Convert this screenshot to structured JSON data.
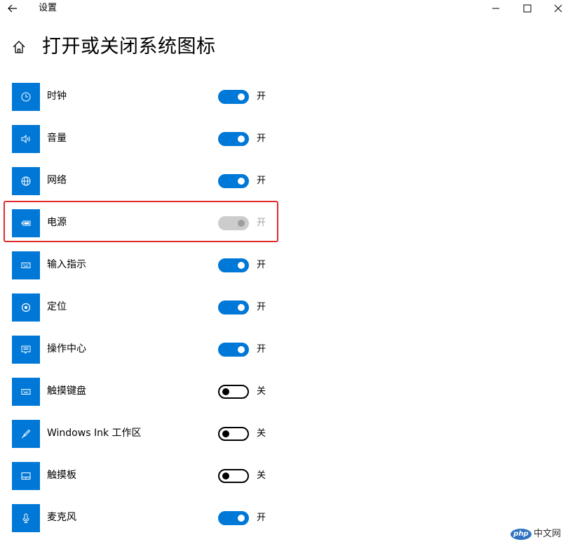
{
  "window": {
    "title": "设置",
    "back_icon": "back-arrow-icon",
    "controls": [
      "minimize-icon",
      "maximize-icon",
      "close-icon"
    ]
  },
  "header": {
    "home_icon": "home-icon",
    "title": "打开或关闭系统图标"
  },
  "items": [
    {
      "label": "时钟",
      "icon": "clock-icon",
      "state": "开",
      "on": true,
      "disabled": false
    },
    {
      "label": "音量",
      "icon": "volume-icon",
      "state": "开",
      "on": true,
      "disabled": false
    },
    {
      "label": "网络",
      "icon": "globe-icon",
      "state": "开",
      "on": true,
      "disabled": false
    },
    {
      "label": "电源",
      "icon": "battery-icon",
      "state": "开",
      "on": true,
      "disabled": true
    },
    {
      "label": "输入指示",
      "icon": "keyboard-icon",
      "state": "开",
      "on": true,
      "disabled": false
    },
    {
      "label": "定位",
      "icon": "location-icon",
      "state": "开",
      "on": true,
      "disabled": false
    },
    {
      "label": "操作中心",
      "icon": "action-center-icon",
      "state": "开",
      "on": true,
      "disabled": false
    },
    {
      "label": "触摸键盘",
      "icon": "keyboard-icon",
      "state": "关",
      "on": false,
      "disabled": false
    },
    {
      "label": "Windows Ink 工作区",
      "icon": "pen-icon",
      "state": "关",
      "on": false,
      "disabled": false
    },
    {
      "label": "触摸板",
      "icon": "touchpad-icon",
      "state": "关",
      "on": false,
      "disabled": false
    },
    {
      "label": "麦克风",
      "icon": "microphone-icon",
      "state": "开",
      "on": true,
      "disabled": false
    }
  ],
  "colors": {
    "accent": "#0078d7",
    "highlight_border": "#e02b2b",
    "disabled_toggle": "#cccccc"
  },
  "watermark": {
    "logo": "php",
    "text": "中文网"
  }
}
